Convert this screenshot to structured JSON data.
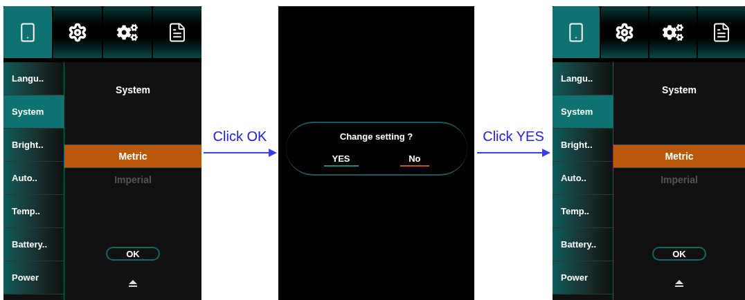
{
  "steps": [
    {
      "kind": "settings",
      "tabs": [
        {
          "selected": true
        },
        {
          "selected": false
        },
        {
          "selected": false
        },
        {
          "selected": false
        }
      ],
      "sidebar": [
        {
          "label": "Langu..",
          "selected": false
        },
        {
          "label": "System",
          "selected": true
        },
        {
          "label": "Bright..",
          "selected": false
        },
        {
          "label": "Auto..",
          "selected": false
        },
        {
          "label": "Temp..",
          "selected": false
        },
        {
          "label": "Battery..",
          "selected": false
        },
        {
          "label": "Power",
          "selected": false
        }
      ],
      "title": "System",
      "options": [
        {
          "label": "Metric",
          "selected": true
        },
        {
          "label": "Imperial",
          "selected": false
        }
      ],
      "ok_label": "OK"
    },
    {
      "kind": "arrow",
      "label": "Click OK"
    },
    {
      "kind": "dialog",
      "message": "Change setting ?",
      "buttons": [
        {
          "label": "YES",
          "color": "#1a8a8a"
        },
        {
          "label": "No",
          "color": "#c0600a"
        }
      ]
    },
    {
      "kind": "arrow",
      "label": "Click YES"
    },
    {
      "kind": "settings",
      "tabs": [
        {
          "selected": true
        },
        {
          "selected": false
        },
        {
          "selected": false
        },
        {
          "selected": false
        }
      ],
      "sidebar": [
        {
          "label": "Langu..",
          "selected": false
        },
        {
          "label": "System",
          "selected": true
        },
        {
          "label": "Bright..",
          "selected": false
        },
        {
          "label": "Auto..",
          "selected": false
        },
        {
          "label": "Temp..",
          "selected": false
        },
        {
          "label": "Battery..",
          "selected": false
        },
        {
          "label": "Power",
          "selected": false
        }
      ],
      "title": "System",
      "options": [
        {
          "label": "Metric",
          "selected": true
        },
        {
          "label": "Imperial",
          "selected": false
        }
      ],
      "ok_label": "OK"
    }
  ]
}
